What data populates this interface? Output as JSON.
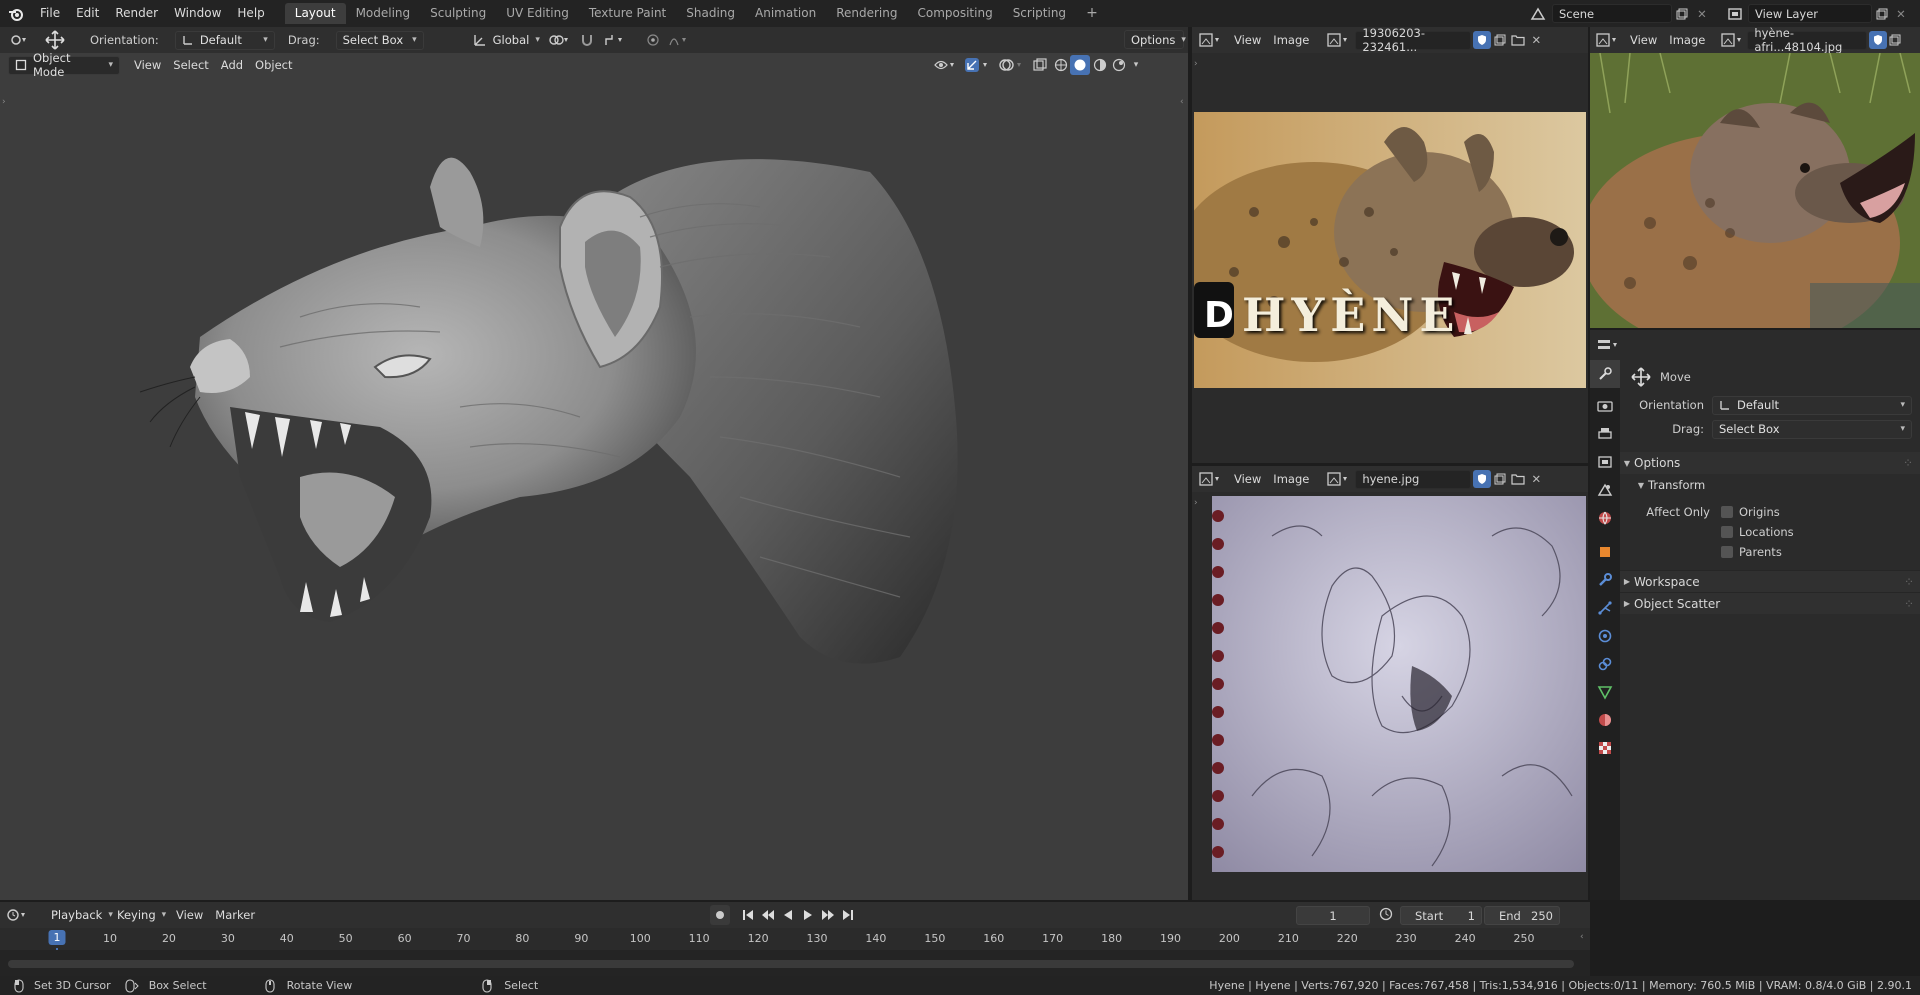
{
  "menu": {
    "items": [
      "File",
      "Edit",
      "Render",
      "Window",
      "Help"
    ]
  },
  "workspaces": {
    "tabs": [
      "Layout",
      "Modeling",
      "Sculpting",
      "UV Editing",
      "Texture Paint",
      "Shading",
      "Animation",
      "Rendering",
      "Compositing",
      "Scripting"
    ],
    "active": "Layout",
    "add_label": "+"
  },
  "scene": {
    "name": "Scene",
    "view_layer": "View Layer"
  },
  "tool_header": {
    "orientation_label": "Orientation:",
    "orientation_value": "Default",
    "drag_label": "Drag:",
    "drag_value": "Select Box",
    "transform_orientation": "Global",
    "options_label": "Options"
  },
  "viewport": {
    "mode": "Object Mode",
    "menus": [
      "View",
      "Select",
      "Add",
      "Object"
    ]
  },
  "image_editor_top": {
    "menus": [
      "View",
      "Image"
    ],
    "image_name": "19306203-232461...",
    "overlay_text": "HYÈNE"
  },
  "image_editor_bottom": {
    "menus": [
      "View",
      "Image"
    ],
    "image_name": "hyene.jpg"
  },
  "image_editor_right": {
    "menus": [
      "View",
      "Image"
    ],
    "image_name": "hyène-afri...48104.jpg"
  },
  "properties": {
    "tool_name": "Move",
    "orientation_label": "Orientation",
    "orientation_value": "Default",
    "drag_label": "Drag:",
    "drag_value": "Select Box",
    "options_label": "Options",
    "transform_label": "Transform",
    "affect_only_label": "Affect Only",
    "affect_options": [
      "Origins",
      "Locations",
      "Parents"
    ],
    "workspace_label": "Workspace",
    "object_scatter_label": "Object Scatter"
  },
  "timeline": {
    "menus": [
      "Playback",
      "Keying",
      "View",
      "Marker"
    ],
    "current_frame": "1",
    "start_label": "Start",
    "start_value": "1",
    "end_label": "End",
    "end_value": "250",
    "ticks": [
      "1",
      "10",
      "20",
      "30",
      "40",
      "50",
      "60",
      "70",
      "80",
      "90",
      "100",
      "110",
      "120",
      "130",
      "140",
      "150",
      "160",
      "170",
      "180",
      "190",
      "200",
      "210",
      "220",
      "230",
      "240",
      "250"
    ]
  },
  "statusbar": {
    "hint1": "Set 3D Cursor",
    "hint2": "Box Select",
    "hint3": "Rotate View",
    "hint4": "Select",
    "stats": "Hyene | Hyene | Verts:767,920 | Faces:767,458 | Tris:1,534,916 | Objects:0/11 | Memory: 760.5 MiB | VRAM: 0.8/4.0 GiB | 2.90.1"
  },
  "colors": {
    "accent_blue": "#4772b3",
    "viewport_bg": "#3d3d3d",
    "panel_bg": "#2b2b2b",
    "header_bg": "#2f2f2f"
  }
}
